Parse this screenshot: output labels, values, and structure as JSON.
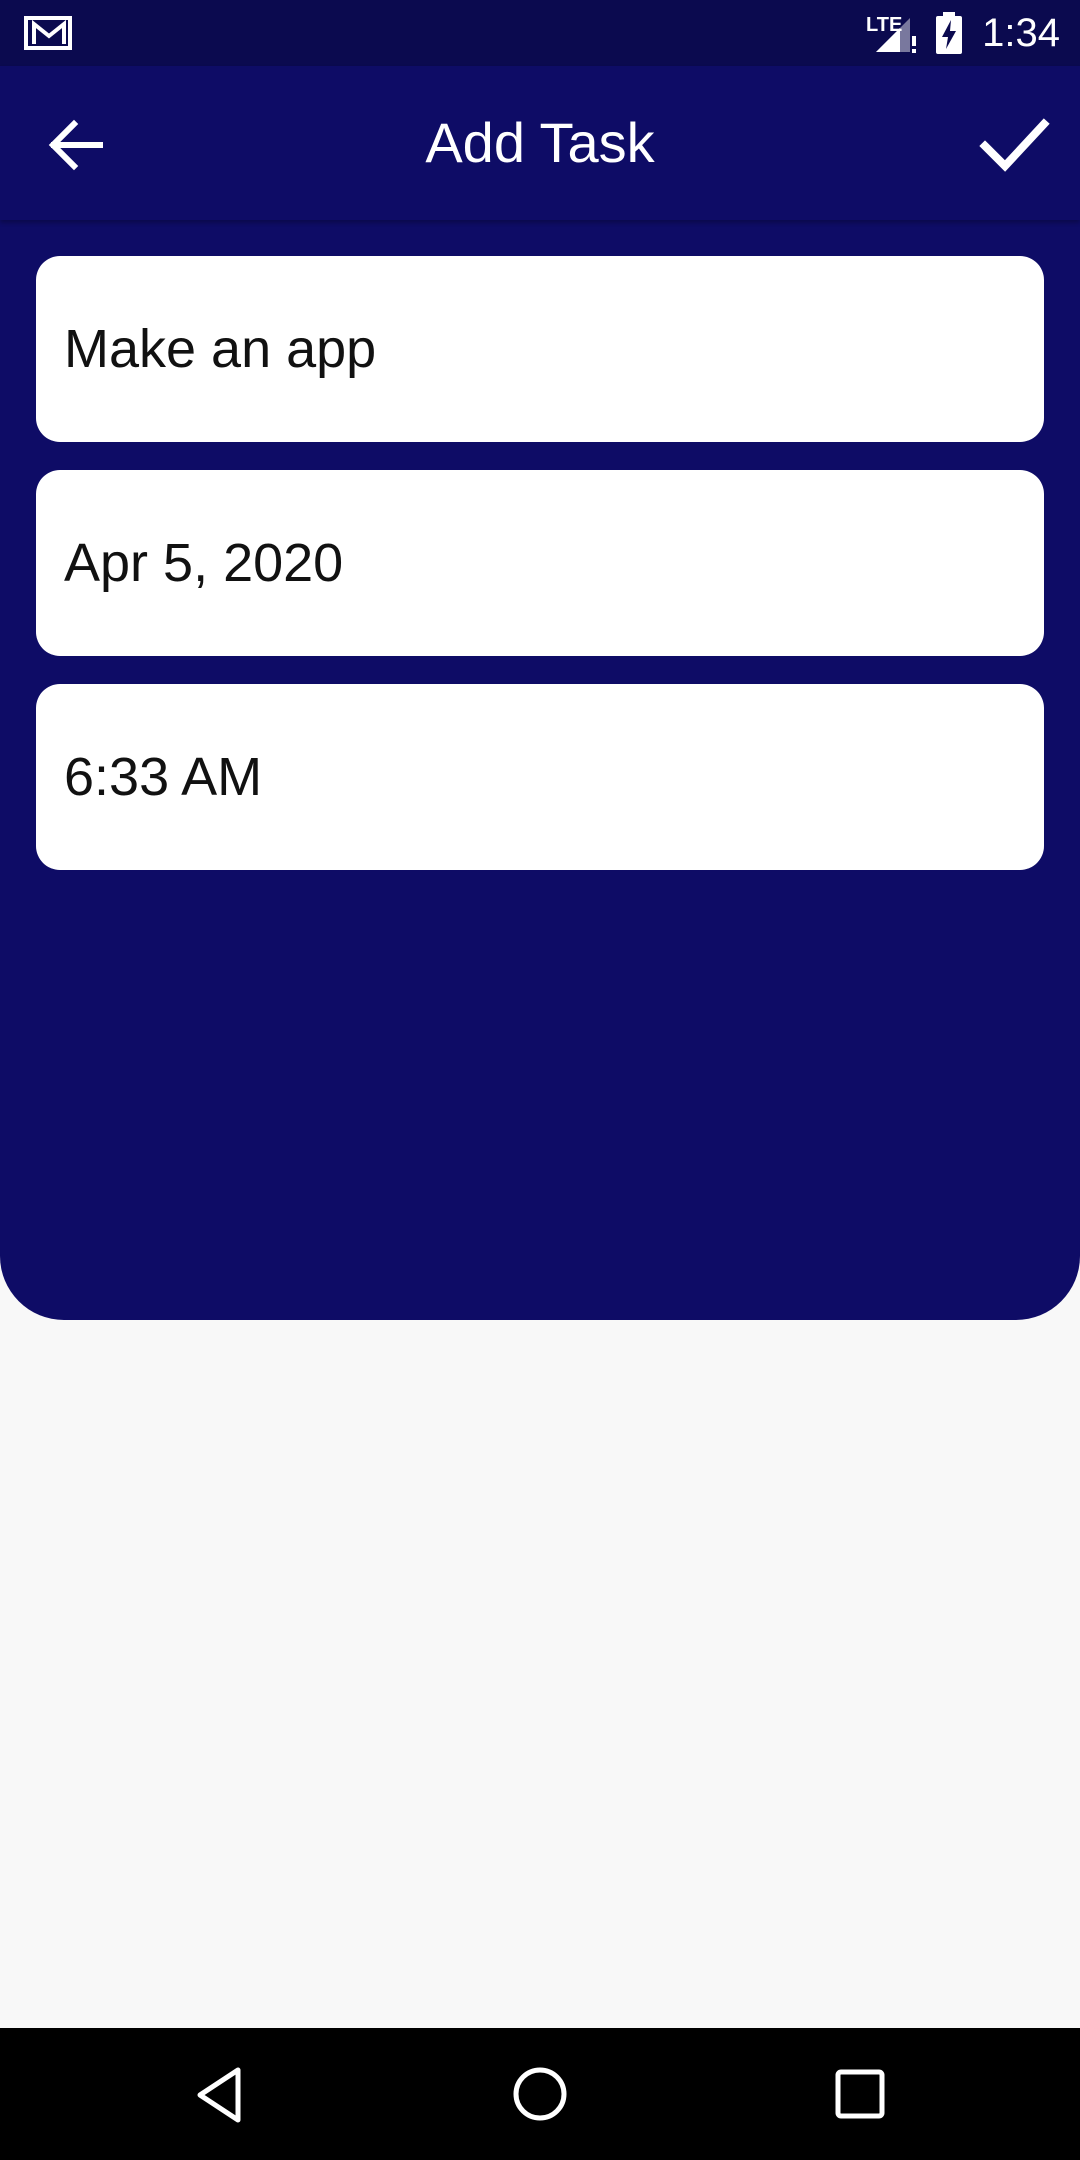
{
  "status_bar": {
    "network": "LTE",
    "time": "1:34",
    "icons": [
      "gmail-icon",
      "signal-icon",
      "battery-charging-icon"
    ]
  },
  "app_bar": {
    "title": "Add Task",
    "back_icon": "arrow-back-icon",
    "confirm_icon": "check-icon"
  },
  "form": {
    "task_name": "Make an app",
    "date": "Apr 5, 2020",
    "time": "6:33 AM"
  },
  "nav_bar": {
    "icons": [
      "nav-back-icon",
      "nav-home-icon",
      "nav-recents-icon"
    ]
  },
  "colors": {
    "primary": "#0e0c66",
    "status_bar": "#0b0a4f",
    "background": "#f8f8f8",
    "field": "#ffffff"
  }
}
